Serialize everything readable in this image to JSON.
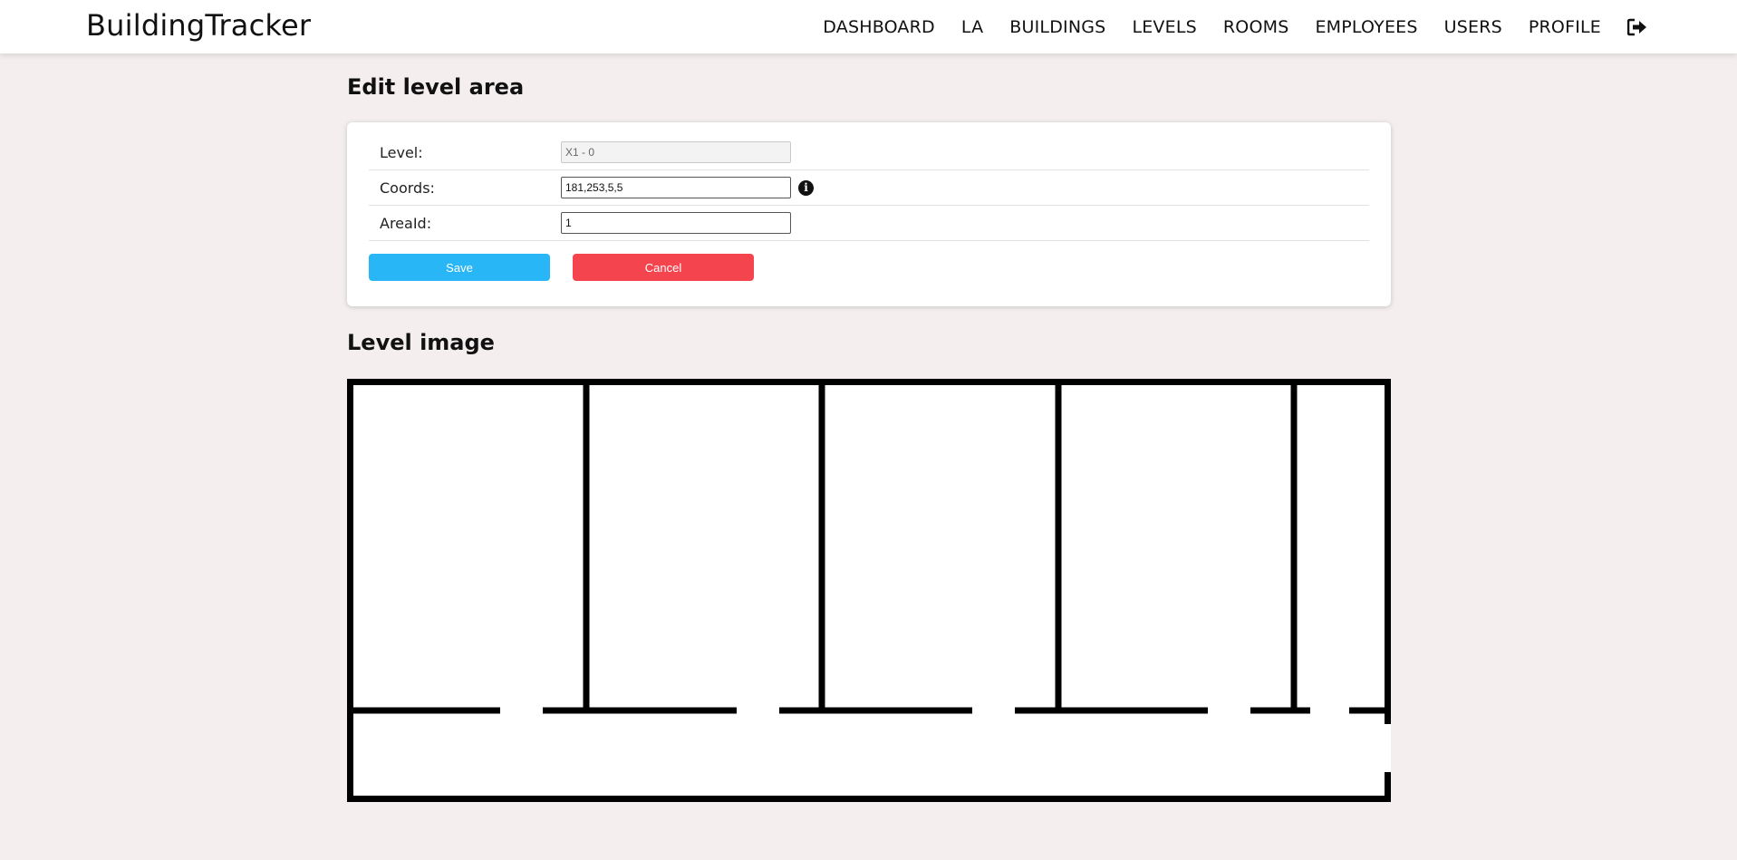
{
  "app": {
    "title": "BuildingTracker"
  },
  "nav": {
    "items": [
      {
        "label": "DASHBOARD"
      },
      {
        "label": "LA"
      },
      {
        "label": "BUILDINGS"
      },
      {
        "label": "LEVELS"
      },
      {
        "label": "ROOMS"
      },
      {
        "label": "EMPLOYEES"
      },
      {
        "label": "USERS"
      },
      {
        "label": "PROFILE"
      }
    ],
    "logout_icon": "sign-out-icon"
  },
  "edit_section": {
    "title": "Edit level area",
    "fields": {
      "level": {
        "label": "Level:",
        "value": "X1 - 0"
      },
      "coords": {
        "label": "Coords:",
        "value": "181,253,5,5"
      },
      "area_id": {
        "label": "AreaId:",
        "value": "1"
      }
    },
    "info_icon": "info-circle-icon",
    "save_label": "Save",
    "cancel_label": "Cancel"
  },
  "image_section": {
    "title": "Level image"
  },
  "colors": {
    "background": "#f4eeee",
    "save_button": "#29b6f6",
    "cancel_button": "#f4444d"
  }
}
